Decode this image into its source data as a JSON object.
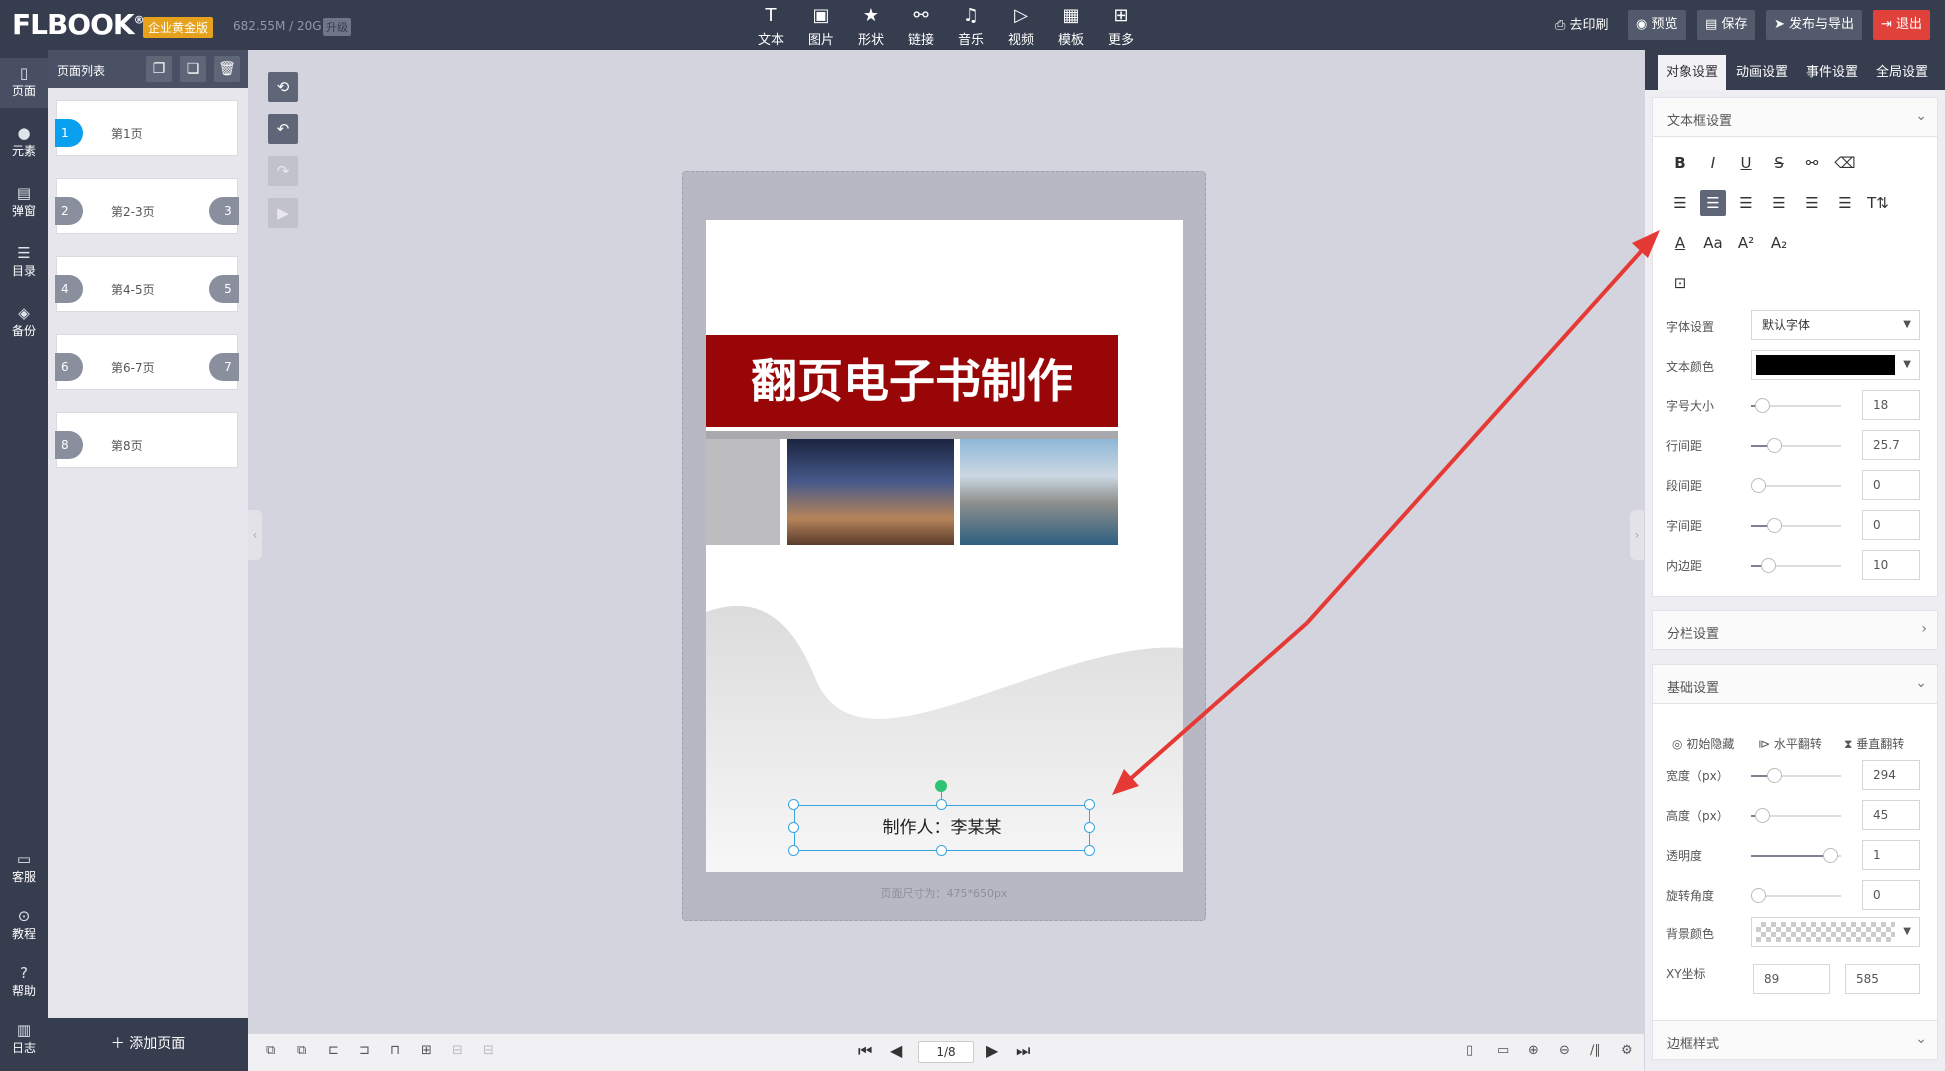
{
  "topbar": {
    "logo": "FLBOOK",
    "logo_mark": "®",
    "edition": "企业黄金版",
    "storage": "682.55M / 20G",
    "upgrade": "升级",
    "tools": [
      {
        "label": "文本",
        "icon": "text-icon"
      },
      {
        "label": "图片",
        "icon": "image-icon"
      },
      {
        "label": "形状",
        "icon": "star-icon"
      },
      {
        "label": "链接",
        "icon": "link-icon"
      },
      {
        "label": "音乐",
        "icon": "music-icon"
      },
      {
        "label": "视频",
        "icon": "video-icon"
      },
      {
        "label": "模板",
        "icon": "template-icon"
      },
      {
        "label": "更多",
        "icon": "more-icon"
      }
    ],
    "print": "去印刷",
    "preview": "预览",
    "save": "保存",
    "publish": "发布与导出",
    "exit": "退出"
  },
  "rail": [
    {
      "label": "页面",
      "icon": "page-icon"
    },
    {
      "label": "元素",
      "icon": "element-icon"
    },
    {
      "label": "弹窗",
      "icon": "popup-icon"
    },
    {
      "label": "目录",
      "icon": "toc-icon"
    },
    {
      "label": "备份",
      "icon": "backup-icon"
    }
  ],
  "rail_bottom": [
    {
      "label": "客服",
      "icon": "chat-icon"
    },
    {
      "label": "教程",
      "icon": "play-icon"
    },
    {
      "label": "帮助",
      "icon": "help-icon"
    },
    {
      "label": "日志",
      "icon": "log-icon"
    }
  ],
  "page_list": {
    "title": "页面列表",
    "pages": [
      {
        "num": "1",
        "num_right": "",
        "label": "第1页"
      },
      {
        "num": "2",
        "num_right": "3",
        "label": "第2-3页"
      },
      {
        "num": "4",
        "num_right": "5",
        "label": "第4-5页"
      },
      {
        "num": "6",
        "num_right": "7",
        "label": "第6-7页"
      },
      {
        "num": "8",
        "num_right": "",
        "label": "第8页"
      }
    ],
    "add_page": "添加页面"
  },
  "canvas": {
    "title": "翻页电子书制作",
    "textbox": "制作人：李某某",
    "page_size": "页面尺寸为：475*650px"
  },
  "pager": {
    "value": "1/8"
  },
  "right_panel": {
    "tabs": [
      "对象设置",
      "动画设置",
      "事件设置",
      "全局设置"
    ],
    "textbox_section": "文本框设置",
    "font_label": "字体设置",
    "font_value": "默认字体",
    "color_label": "文本颜色",
    "text_color": "#000000",
    "sliders": [
      {
        "label": "字号大小",
        "value": "18",
        "level": 0.05
      },
      {
        "label": "行间距",
        "value": "25.7",
        "level": 0.2
      },
      {
        "label": "段间距",
        "value": "0",
        "level": 0
      },
      {
        "label": "字间距",
        "value": "0",
        "level": 0.2
      },
      {
        "label": "内边距",
        "value": "10",
        "level": 0.12
      }
    ],
    "column_section": "分栏设置",
    "basic_section": "基础设置",
    "basic_toggles": [
      "初始隐藏",
      "水平翻转",
      "垂直翻转"
    ],
    "basic_sliders": [
      {
        "label": "宽度（px）",
        "value": "294",
        "level": 0.2
      },
      {
        "label": "高度（px）",
        "value": "45",
        "level": 0.05
      },
      {
        "label": "透明度",
        "value": "1",
        "level": 0.9
      },
      {
        "label": "旋转角度",
        "value": "0",
        "level": 0
      }
    ],
    "bg_label": "背景颜色",
    "xy_label": "XY坐标",
    "x": "89",
    "y": "585",
    "border_section": "边框样式"
  }
}
